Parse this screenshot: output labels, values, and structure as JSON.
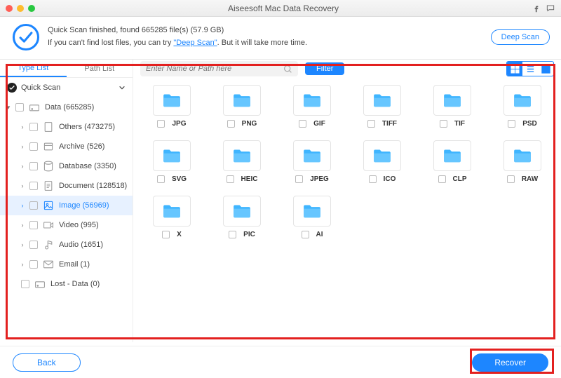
{
  "titlebar": {
    "title": "Aiseesoft Mac Data Recovery"
  },
  "header": {
    "line1": "Quick Scan finished, found 665285 file(s) (57.9 GB)",
    "line2_pre": "If you can't find lost files, you can try ",
    "deep_link": "\"Deep Scan\"",
    "line2_post": ". But it will take more time.",
    "deep_btn": "Deep Scan"
  },
  "sidebar": {
    "tabs": {
      "type": "Type List",
      "path": "Path List"
    },
    "quickscan": "Quick Scan",
    "root": "Data (665285)",
    "items": [
      {
        "label": "Others (473275)",
        "icon": "file"
      },
      {
        "label": "Archive (526)",
        "icon": "archive"
      },
      {
        "label": "Database (3350)",
        "icon": "db"
      },
      {
        "label": "Document (128518)",
        "icon": "doc"
      },
      {
        "label": "Image (56969)",
        "icon": "image",
        "selected": true
      },
      {
        "label": "Video (995)",
        "icon": "video"
      },
      {
        "label": "Audio (1651)",
        "icon": "audio"
      },
      {
        "label": "Email (1)",
        "icon": "mail"
      }
    ],
    "lost": "Lost - Data (0)"
  },
  "toolbar": {
    "search_placeholder": "Enter Name or Path here",
    "filter": "Filter"
  },
  "grid": {
    "items": [
      "JPG",
      "PNG",
      "GIF",
      "TIFF",
      "TIF",
      "PSD",
      "SVG",
      "HEIC",
      "JPEG",
      "ICO",
      "CLP",
      "RAW",
      "X",
      "PIC",
      "AI"
    ]
  },
  "footer": {
    "back": "Back",
    "recover": "Recover"
  }
}
